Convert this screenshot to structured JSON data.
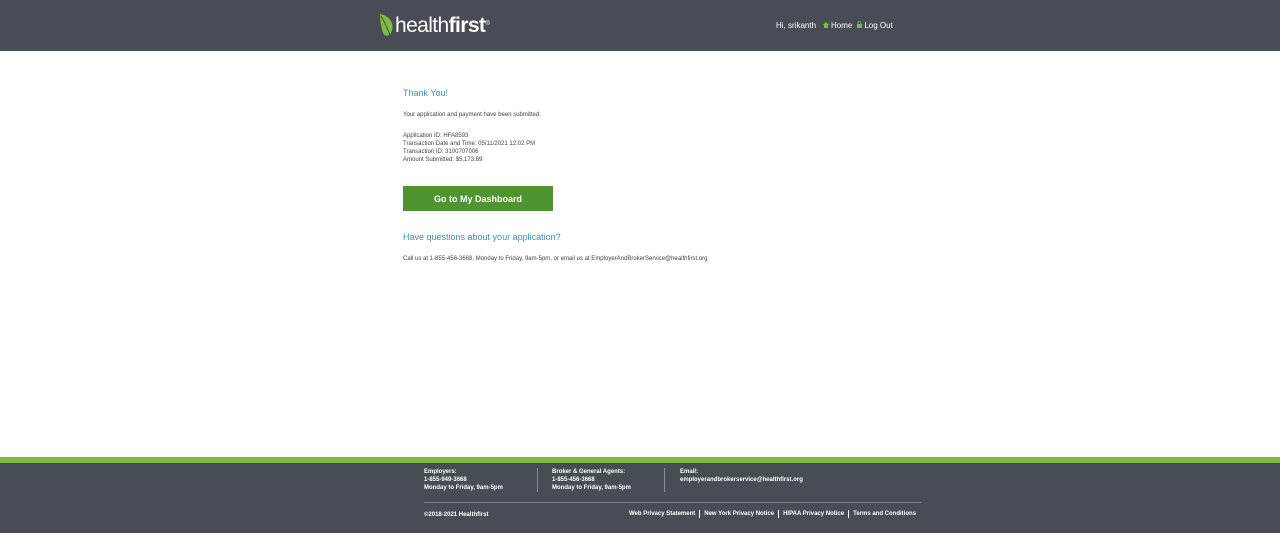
{
  "header": {
    "logo": {
      "text_light": "health",
      "text_bold": "first",
      "tm": "®",
      "icon": "leaf-icon",
      "leaf_color": "#7dbb42"
    },
    "greeting": "Hi, srikanth",
    "nav": {
      "home_label": "Home",
      "logout_label": "Log Out",
      "home_icon": "home-icon",
      "logout_icon": "lock-icon",
      "icon_color": "#7dbb42"
    },
    "background": "#484c55"
  },
  "main": {
    "title": "Thank You!",
    "submitted_text": "Your application and payment have been submitted.",
    "details": [
      "Application ID: HFA8593",
      "Transaction Date and Time: 05/11/2021 12:02 PM",
      "Transaction ID: 3100707006",
      "Amount Submitted: $5,173.89"
    ],
    "dashboard_button": "Go to My Dashboard",
    "questions_heading": "Have questions about your application?",
    "call_text": "Call us at 1-855-456-3668, Monday to Friday, 9am-5pm, or email us at EmployerAndBrokerService@healthfirst.org",
    "accent_color": "#3c8fc2",
    "button_color": "#4e9431"
  },
  "footer": {
    "employers": {
      "label": "Employers:",
      "phone": "1-855-949-3668",
      "hours": "Monday to Friday, 9am-5pm"
    },
    "brokers": {
      "label": "Broker & General Agents:",
      "phone": "1-855-456-3668",
      "hours": "Monday to Friday, 9am-5pm"
    },
    "email": {
      "label": "Email:",
      "address": "employerandbrokerservice@healthfirst.org"
    },
    "copyright": "©2018-2021 Healthfirst",
    "links": {
      "web_privacy": "Web Privacy Statement",
      "ny_privacy": "New York Privacy Notice",
      "hipaa": "HIPAA Privacy Notice",
      "terms": "Terms and Conditions"
    },
    "green_bar_color": "#7dbb42"
  }
}
